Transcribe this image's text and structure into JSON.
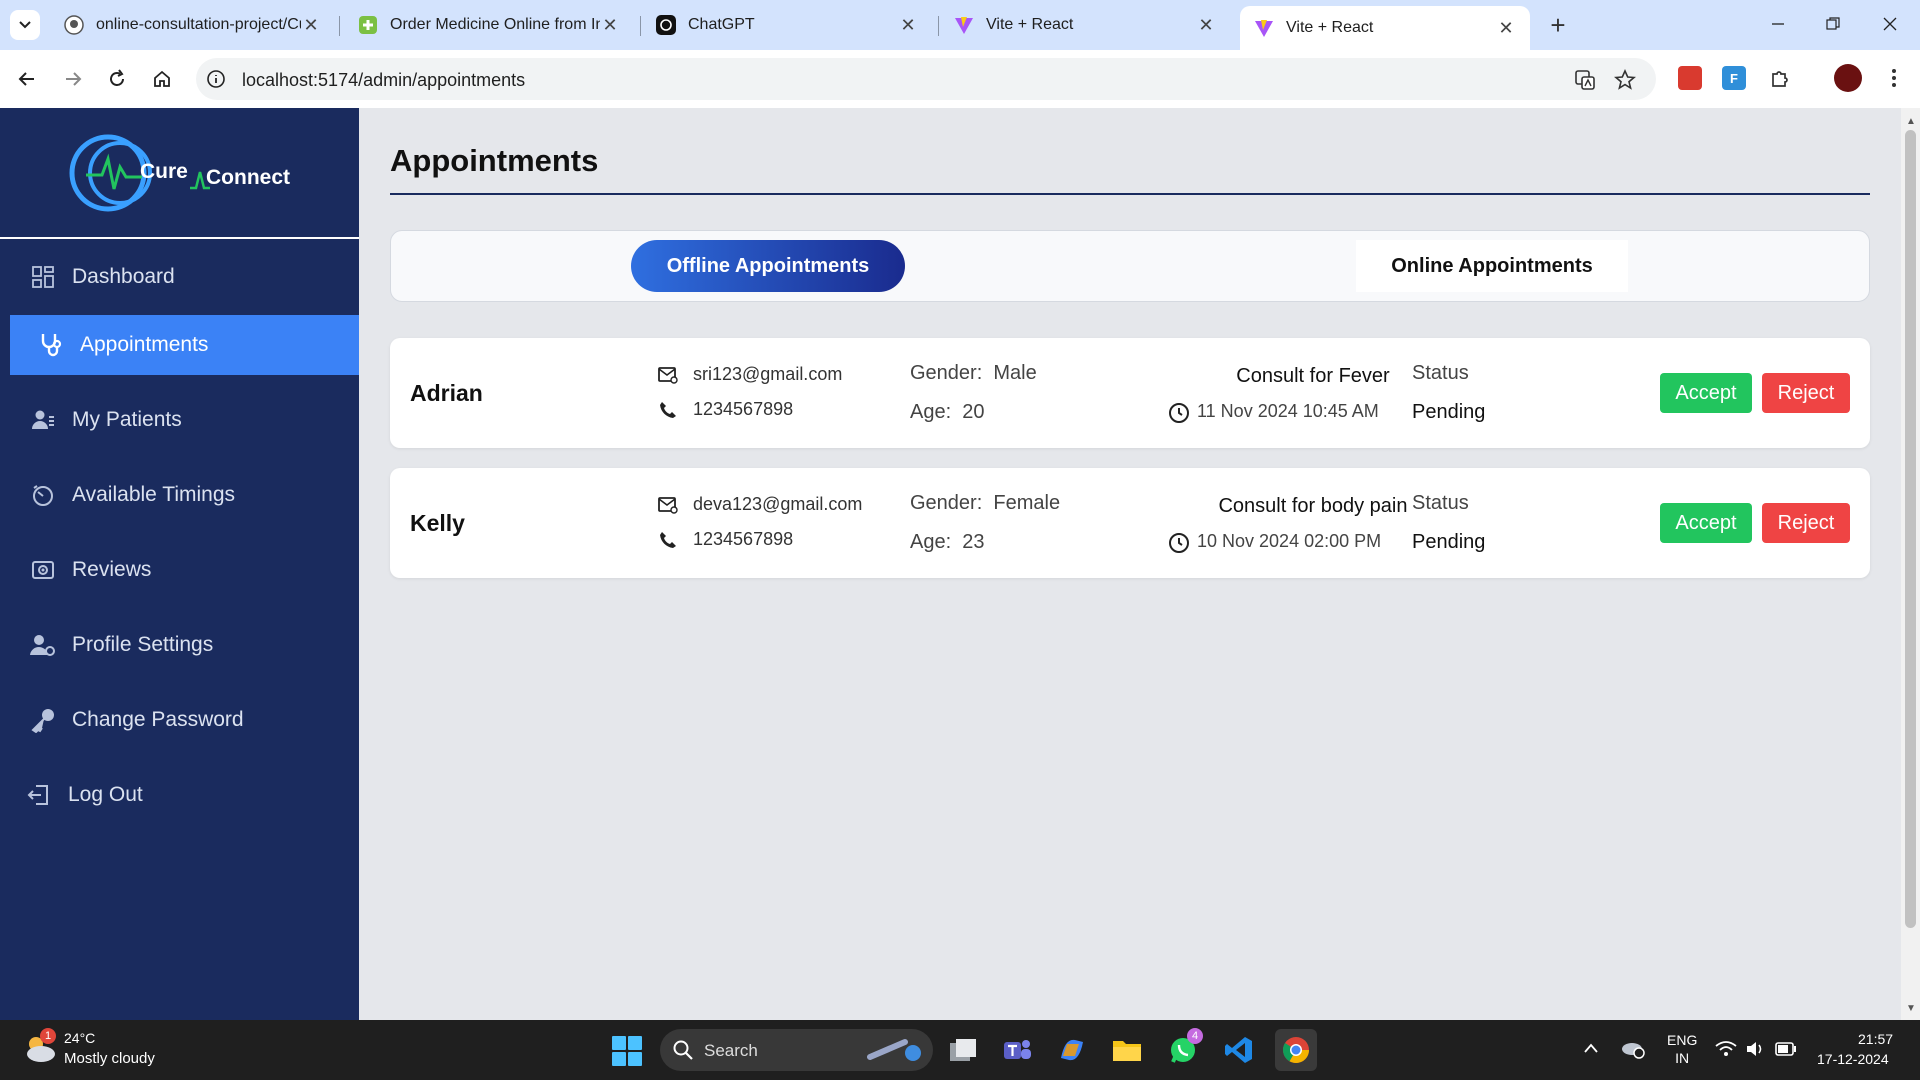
{
  "browser": {
    "tabs": [
      {
        "title": "online-consultation-project/Cu",
        "active": false
      },
      {
        "title": "Order Medicine Online from Ind",
        "active": false
      },
      {
        "title": "ChatGPT",
        "active": false
      },
      {
        "title": "Vite + React",
        "active": false
      },
      {
        "title": "Vite + React",
        "active": true
      }
    ],
    "tab_close_glyph": "✕",
    "new_tab_glyph": "+",
    "url": "localhost:5174/admin/appointments"
  },
  "sidebar": {
    "logo": {
      "word1": "Cure",
      "word2": "Connect"
    },
    "items": [
      {
        "label": "Dashboard",
        "icon": "dashboard-grid-icon",
        "active": false
      },
      {
        "label": "Appointments",
        "icon": "stethoscope-icon",
        "active": true
      },
      {
        "label": "My Patients",
        "icon": "patients-icon",
        "active": false
      },
      {
        "label": "Available Timings",
        "icon": "timer-icon",
        "active": false
      },
      {
        "label": "Reviews",
        "icon": "reviews-icon",
        "active": false
      },
      {
        "label": "Profile Settings",
        "icon": "user-cog-icon",
        "active": false
      },
      {
        "label": "Change Password",
        "icon": "key-icon",
        "active": false
      },
      {
        "label": "Log Out",
        "icon": "logout-icon",
        "active": false
      }
    ]
  },
  "main": {
    "title": "Appointments",
    "tabs": {
      "offline": "Offline Appointments",
      "online": "Online Appointments",
      "selected": "offline"
    },
    "appointments": [
      {
        "name": "Adrian",
        "email": "sri123@gmail.com",
        "phone": "1234567898",
        "gender_label": "Gender:",
        "gender": "Male",
        "age_label": "Age:",
        "age": "20",
        "consult": "Consult for Fever",
        "datetime": "11 Nov 2024 10:45 AM",
        "status_label": "Status",
        "status": "Pending",
        "accept": "Accept",
        "reject": "Reject"
      },
      {
        "name": "Kelly",
        "email": "deva123@gmail.com",
        "phone": "1234567898",
        "gender_label": "Gender:",
        "gender": "Female",
        "age_label": "Age:",
        "age": "23",
        "consult": "Consult for body pain",
        "datetime": "10 Nov 2024 02:00 PM",
        "status_label": "Status",
        "status": "Pending",
        "accept": "Accept",
        "reject": "Reject"
      }
    ]
  },
  "taskbar": {
    "weather": {
      "temp": "24°C",
      "desc": "Mostly cloudy",
      "badge": "1"
    },
    "search_placeholder": "Search",
    "whatsapp_badge": "4",
    "lang": {
      "line1": "ENG",
      "line2": "IN"
    },
    "time": "21:57",
    "date": "17-12-2024"
  },
  "colors": {
    "sidebar_bg": "#1a2b5e",
    "active_item": "#3b82f6",
    "accept": "#22c55e",
    "reject": "#ef4444",
    "main_bg": "#e5e7eb"
  }
}
